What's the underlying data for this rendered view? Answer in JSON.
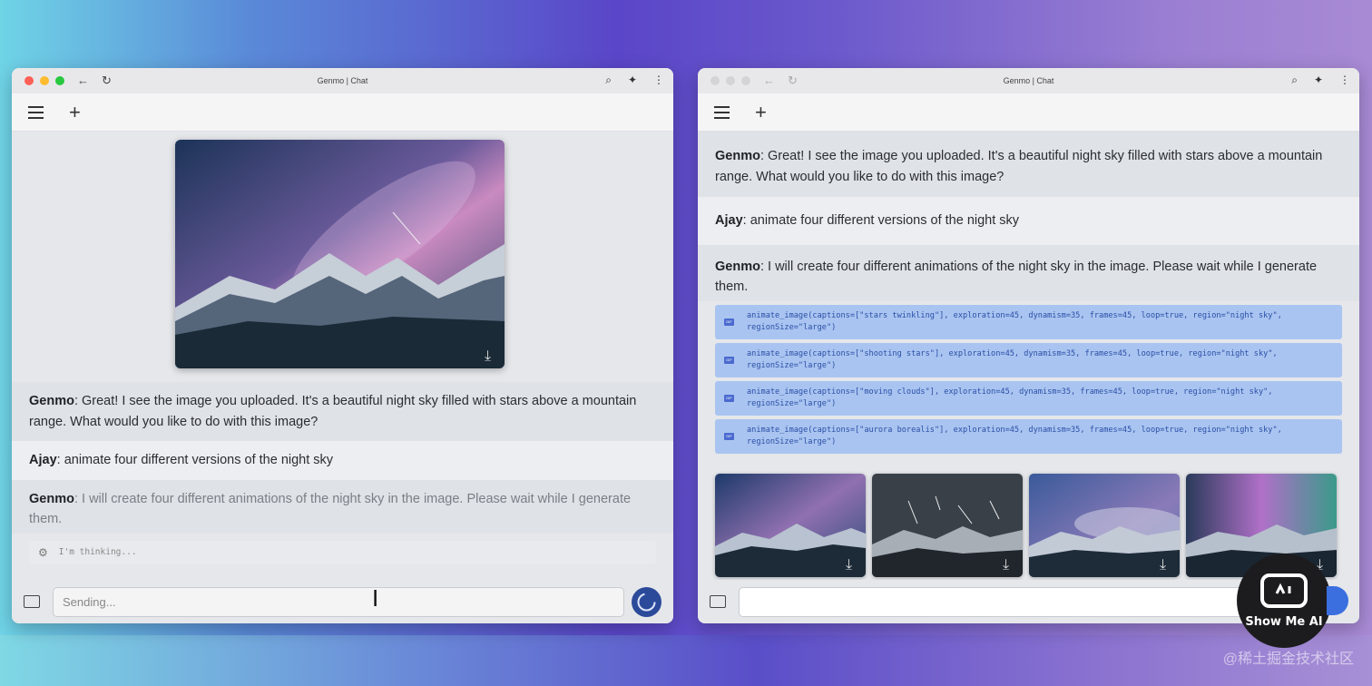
{
  "window_title": "Genmo | Chat",
  "left": {
    "messages": [
      {
        "speaker": "Genmo",
        "text": ": Great! I see the image you uploaded. It's a beautiful night sky filled with stars above a mountain range. What would you like to do with this image?"
      },
      {
        "speaker": "Ajay",
        "text": ": animate four different versions of the night sky"
      },
      {
        "speaker": "Genmo",
        "text": ": I will create four different animations of the night sky in the image. Please wait while I generate them."
      }
    ],
    "thinking_text": "I'm thinking...",
    "input_placeholder": "Sending..."
  },
  "right": {
    "messages": [
      {
        "speaker": "Genmo",
        "text": ": Great! I see the image you uploaded. It's a beautiful night sky filled with stars above a mountain range. What would you like to do with this image?"
      },
      {
        "speaker": "Ajay",
        "text": ": animate four different versions of the night sky"
      },
      {
        "speaker": "Genmo",
        "text": ": I will create four different animations of the night sky in the image. Please wait while I generate them."
      }
    ],
    "calls": [
      "animate_image(captions=[\"stars twinkling\"], exploration=45, dynamism=35, frames=45, loop=true, region=\"night sky\", regionSize=\"large\")",
      "animate_image(captions=[\"shooting stars\"], exploration=45, dynamism=35, frames=45, loop=true, region=\"night sky\", regionSize=\"large\")",
      "animate_image(captions=[\"moving clouds\"], exploration=45, dynamism=35, frames=45, loop=true, region=\"night sky\", regionSize=\"large\")",
      "animate_image(captions=[\"aurora borealis\"], exploration=45, dynamism=35, frames=45, loop=true, region=\"night sky\", regionSize=\"large\")"
    ]
  },
  "badge_label": "Show Me AI",
  "watermark": "@稀土掘金技术社区"
}
